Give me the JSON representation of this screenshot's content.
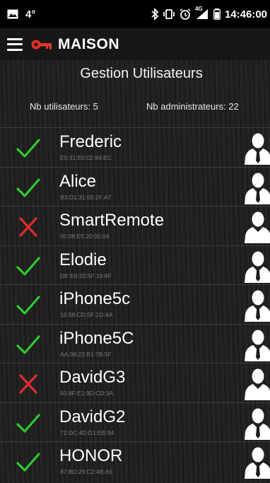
{
  "status_bar": {
    "signal_text": "4°",
    "network": "4G",
    "time": "14:46:00",
    "icons": [
      "image-icon",
      "bluetooth-icon",
      "vibrate-icon",
      "alarm-icon",
      "cell-signal-icon",
      "battery-icon"
    ]
  },
  "app_bar": {
    "title": "MAISON",
    "menu_icon": "hamburger-menu-icon",
    "logo_icon": "key-icon",
    "logo_color": "#e8312a"
  },
  "page": {
    "title": "Gestion Utilisateurs",
    "users_count_label": "Nb utilisateurs: 5",
    "admins_count_label": "Nb administrateurs: 22"
  },
  "colors": {
    "check": "#2fc92f",
    "cross": "#e12b2b",
    "person": "#ffffff"
  },
  "users": [
    {
      "name": "Frederic",
      "mac": "E0:31:E0:02:84:EC",
      "status": "allowed"
    },
    {
      "name": "Alice",
      "mac": "B3:D1:31:65:1F:A7",
      "status": "allowed"
    },
    {
      "name": "SmartRemote",
      "mac": "00:08:E5:20:00:04",
      "status": "denied"
    },
    {
      "name": "Elodie",
      "mac": "DE:E6:32:5F:18:6F",
      "status": "allowed"
    },
    {
      "name": "iPhone5c",
      "mac": "16:58:CD:5F:1D:4A",
      "status": "allowed"
    },
    {
      "name": "iPhone5C",
      "mac": "AA:08:22:B1:7B:5F",
      "status": "allowed"
    },
    {
      "name": "DavidG3",
      "mac": "50:8F:E1:9D:CD:3A",
      "status": "denied"
    },
    {
      "name": "DavidG2",
      "mac": "72:DC:4D:D1:EB:94",
      "status": "allowed"
    },
    {
      "name": "HONOR",
      "mac": "87:BD:29:C2:4B:A5",
      "status": "allowed"
    }
  ]
}
